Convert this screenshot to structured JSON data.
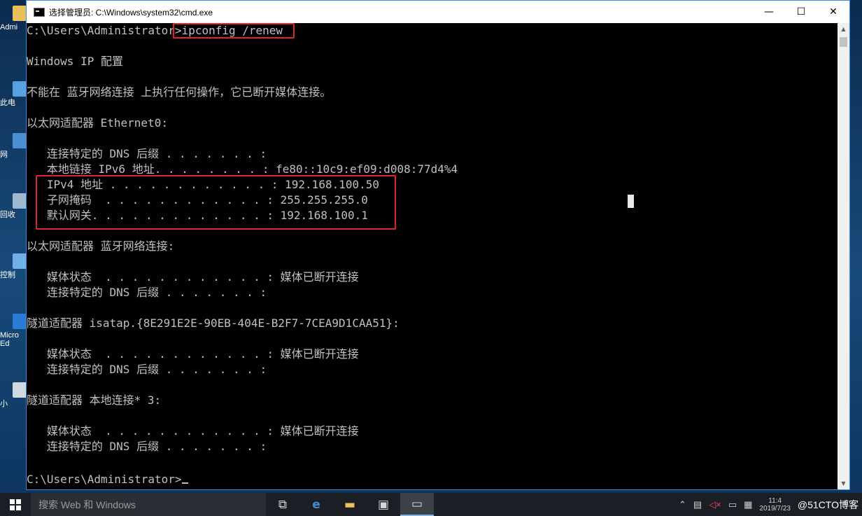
{
  "window": {
    "title": "选择管理员: C:\\Windows\\system32\\cmd.exe",
    "minimize_glyph": "—",
    "maximize_glyph": "☐",
    "close_glyph": "✕"
  },
  "desktop_icons": [
    "Admi",
    "此电",
    "网",
    "回收",
    "控制",
    "Micro Ed",
    "小"
  ],
  "console": {
    "lines": [
      "C:\\Users\\Administrator>ipconfig /renew",
      "",
      "Windows IP 配置",
      "",
      "不能在 蓝牙网络连接 上执行任何操作，它已断开媒体连接。",
      "",
      "以太网适配器 Ethernet0:",
      "",
      "   连接特定的 DNS 后缀 . . . . . . . :",
      "   本地链接 IPv6 地址. . . . . . . . : fe80::10c9:ef09:d008:77d4%4",
      "   IPv4 地址 . . . . . . . . . . . . : 192.168.100.50",
      "   子网掩码  . . . . . . . . . . . . : 255.255.255.0",
      "   默认网关. . . . . . . . . . . . . : 192.168.100.1",
      "",
      "以太网适配器 蓝牙网络连接:",
      "",
      "   媒体状态  . . . . . . . . . . . . : 媒体已断开连接",
      "   连接特定的 DNS 后缀 . . . . . . . :",
      "",
      "隧道适配器 isatap.{8E291E2E-90EB-404E-B2F7-7CEA9D1CAA51}:",
      "",
      "   媒体状态  . . . . . . . . . . . . : 媒体已断开连接",
      "   连接特定的 DNS 后缀 . . . . . . . :",
      "",
      "隧道适配器 本地连接* 3:",
      "",
      "   媒体状态  . . . . . . . . . . . . : 媒体已断开连接",
      "   连接特定的 DNS 后缀 . . . . . . . :",
      "",
      "C:\\Users\\Administrator>"
    ]
  },
  "taskbar": {
    "search_placeholder": "搜索 Web 和 Windows",
    "tray_clock": "11:4",
    "tray_date": "2019/7/23",
    "watermark": "@51CTO博客"
  },
  "colors": {
    "highlight": "#e0242b",
    "console_bg": "#000000",
    "console_fg": "#c0c0c0"
  }
}
